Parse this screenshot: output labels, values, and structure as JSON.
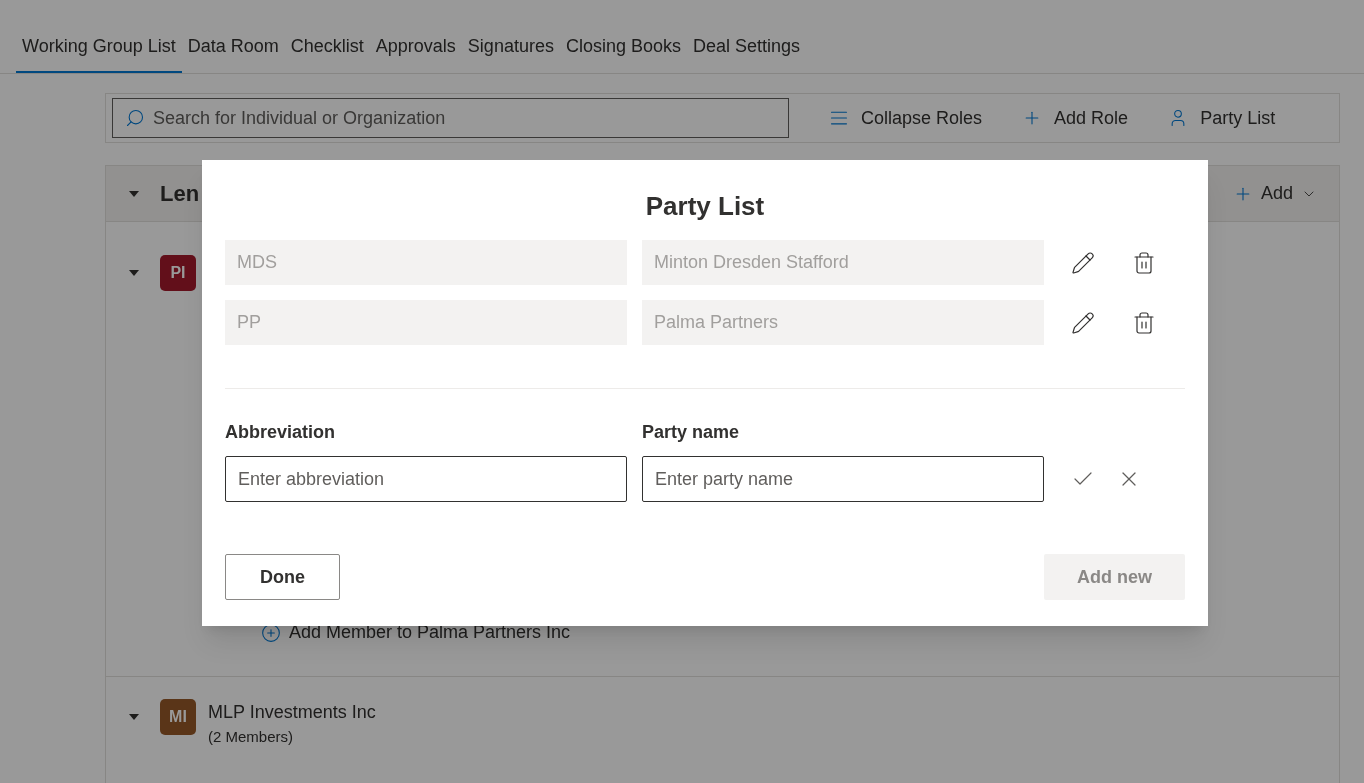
{
  "tabs": [
    {
      "label": "Working Group List",
      "selected": true
    },
    {
      "label": "Data Room",
      "selected": false
    },
    {
      "label": "Checklist",
      "selected": false
    },
    {
      "label": "Approvals",
      "selected": false
    },
    {
      "label": "Signatures",
      "selected": false
    },
    {
      "label": "Closing Books",
      "selected": false
    },
    {
      "label": "Deal Settings",
      "selected": false
    }
  ],
  "toolbar": {
    "search": {
      "placeholder": "Search for Individual or Organization"
    },
    "actions": [
      {
        "kind": "collapse",
        "label": "Collapse Roles"
      },
      {
        "kind": "add",
        "label": "Add Role"
      },
      {
        "kind": "party",
        "label": "Party List"
      }
    ]
  },
  "role_section": {
    "title": "Len",
    "add_label": "Add",
    "expanded": true,
    "groups": [
      {
        "initials": "PI",
        "color": "#620f1a",
        "expanded": true,
        "add_member": "Add Member to Palma Partners Inc"
      },
      {
        "initials": "MI",
        "color": "#5a3518",
        "expanded": true,
        "name": "MLP Investments Inc",
        "count": "(2 Members)"
      }
    ]
  },
  "dialog": {
    "title": "Party List",
    "parties": [
      {
        "abbreviation": "MDS",
        "name": "Minton Dresden Stafford"
      },
      {
        "abbreviation": "PP",
        "name": "Palma Partners"
      }
    ],
    "new_party": {
      "abbreviation_label": "Abbreviation",
      "abbreviation_placeholder": "Enter abbreviation",
      "name_label": "Party name",
      "name_placeholder": "Enter party name"
    },
    "done_label": "Done",
    "add_new": {
      "label": "Add new",
      "disabled": true
    }
  }
}
